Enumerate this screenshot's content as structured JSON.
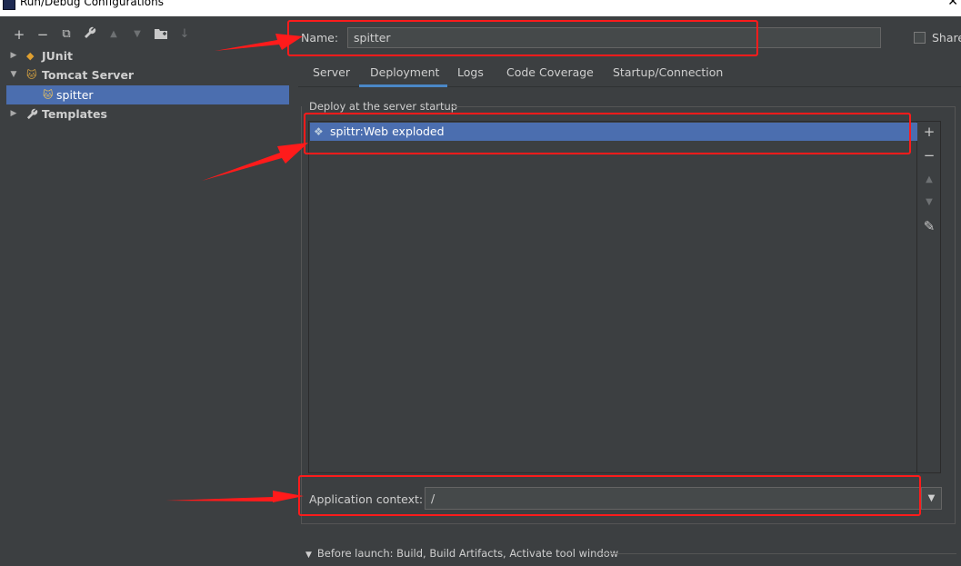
{
  "window": {
    "title": "Run/Debug Configurations",
    "close_glyph": "✕"
  },
  "toolbar": {
    "add": "+",
    "remove": "−",
    "copy": "⧉",
    "edit": "🔧",
    "up": "▲",
    "down": "▼",
    "folder": "📁",
    "sort": "↓"
  },
  "tree": {
    "items": [
      {
        "label": "JUnit",
        "icon": "junit-icon"
      },
      {
        "label": "Tomcat Server",
        "icon": "tomcat-icon"
      },
      {
        "label": "spitter",
        "icon": "tomcat-config-icon"
      },
      {
        "label": "Templates",
        "icon": "wrench-icon"
      }
    ]
  },
  "name_field": {
    "label": "Name:",
    "value": "spitter"
  },
  "share": {
    "label": "Share"
  },
  "tabs": [
    {
      "label": "Server"
    },
    {
      "label": "Deployment"
    },
    {
      "label": "Logs"
    },
    {
      "label": "Code Coverage"
    },
    {
      "label": "Startup/Connection"
    }
  ],
  "active_tab": "Deployment",
  "deployment": {
    "section_title": "Deploy at the server startup",
    "artifacts": [
      {
        "label": "spittr:Web exploded",
        "icon": "artifact-icon"
      }
    ],
    "side_buttons": {
      "add": "+",
      "remove": "−",
      "up": "▲",
      "down": "▼",
      "edit": "✎"
    },
    "app_context_label": "Application context:",
    "app_context_value": "/"
  },
  "before_launch": {
    "label": "Before launch: Build, Build Artifacts, Activate tool window"
  },
  "colors": {
    "background": "#3c3f41",
    "selection": "#4b6eaf",
    "annotation": "#ff1b1b",
    "tab_underline": "#4a88c7"
  }
}
